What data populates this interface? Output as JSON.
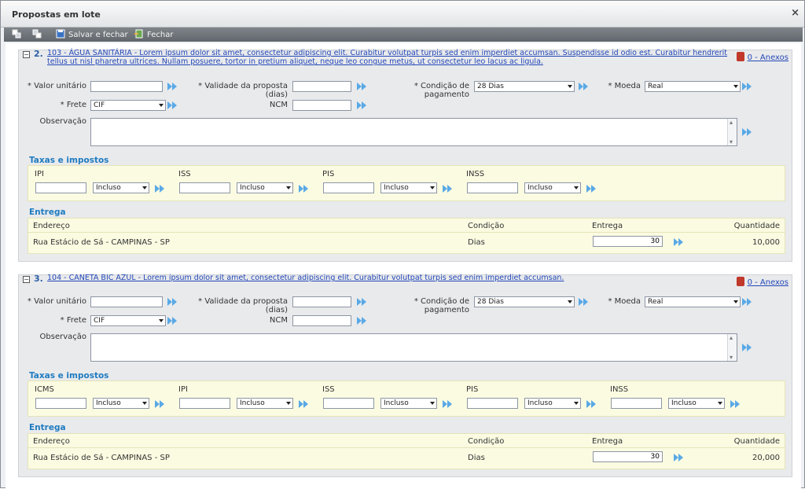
{
  "window": {
    "title": "Propostas em lote",
    "close_label": "×"
  },
  "toolbar": {
    "save_close": "Salvar e fechar",
    "close": "Fechar"
  },
  "items": [
    {
      "number": "2.",
      "title": "103 - ÁGUA SANITÁRIA - Lorem ipsum dolor sit amet, consectetur adipiscing elit. Curabitur volutpat turpis sed enim imperdiet accumsan. Suspendisse id odio est. Curabitur hendrerit tellus ut nisl pharetra ultrices. Nullam posuere, tortor in pretium aliquet, neque leo congue metus, ut consectetur leo lacus ac ligula.",
      "annex": "0 - Anexos",
      "labels": {
        "valor": "* Valor unitário",
        "validade": "* Validade da proposta (dias)",
        "condicao": "* Condição de pagamento",
        "moeda": "* Moeda",
        "frete": "* Frete",
        "ncm": "NCM",
        "obs": "Observação"
      },
      "values": {
        "valor": "",
        "validade": "",
        "condicao": "28 Dias",
        "moeda": "Real",
        "frete": "CIF",
        "ncm": "",
        "obs": ""
      },
      "taxes_title": "Taxas e impostos",
      "taxes": [
        {
          "name": "IPI",
          "value": "",
          "mode": "Incluso"
        },
        {
          "name": "ISS",
          "value": "",
          "mode": "Incluso"
        },
        {
          "name": "PIS",
          "value": "",
          "mode": "Incluso"
        },
        {
          "name": "INSS",
          "value": "",
          "mode": "Incluso"
        }
      ],
      "delivery_title": "Entrega",
      "delivery_headers": {
        "address": "Endereço",
        "condition": "Condição",
        "delivery": "Entrega",
        "quantity": "Quantidade"
      },
      "delivery_row": {
        "address": "Rua Estácio de Sá - CAMPINAS - SP",
        "condition": "Dias",
        "delivery": "30",
        "quantity": "10,000"
      }
    },
    {
      "number": "3.",
      "title": "104 - CANETA BIC AZUL - Lorem ipsum dolor sit amet, consectetur adipiscing elit. Curabitur volutpat turpis sed enim imperdiet accumsan.",
      "annex": "0 - Anexos",
      "labels": {
        "valor": "* Valor unitário",
        "validade": "* Validade da proposta (dias)",
        "condicao": "* Condição de pagamento",
        "moeda": "* Moeda",
        "frete": "* Frete",
        "ncm": "NCM",
        "obs": "Observação"
      },
      "values": {
        "valor": "",
        "validade": "",
        "condicao": "28 Dias",
        "moeda": "Real",
        "frete": "CIF",
        "ncm": "",
        "obs": ""
      },
      "taxes_title": "Taxas e impostos",
      "taxes": [
        {
          "name": "ICMS",
          "value": "",
          "mode": "Incluso"
        },
        {
          "name": "IPI",
          "value": "",
          "mode": "Incluso"
        },
        {
          "name": "ISS",
          "value": "",
          "mode": "Incluso"
        },
        {
          "name": "PIS",
          "value": "",
          "mode": "Incluso"
        },
        {
          "name": "INSS",
          "value": "",
          "mode": "Incluso"
        }
      ],
      "delivery_title": "Entrega",
      "delivery_headers": {
        "address": "Endereço",
        "condition": "Condição",
        "delivery": "Entrega",
        "quantity": "Quantidade"
      },
      "delivery_row": {
        "address": "Rua Estácio de Sá - CAMPINAS - SP",
        "condition": "Dias",
        "delivery": "30",
        "quantity": "20,000"
      }
    }
  ]
}
